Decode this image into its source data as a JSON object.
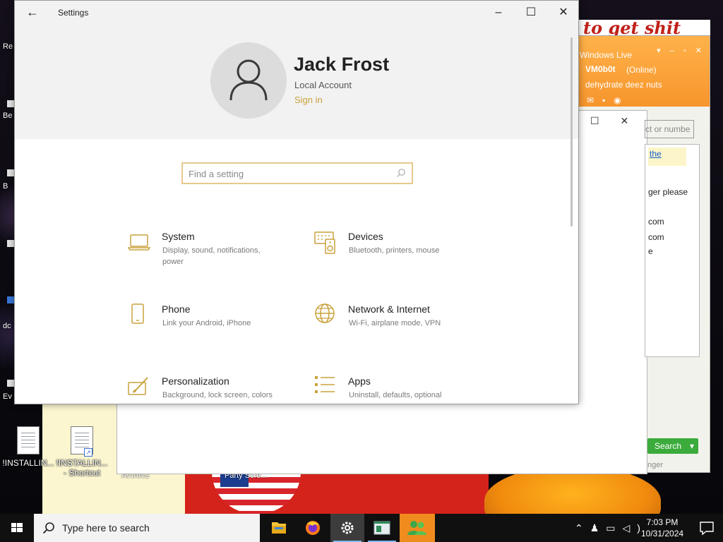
{
  "settings": {
    "title": "Settings",
    "account": {
      "name": "Jack Frost",
      "type": "Local Account",
      "sign_in": "Sign in"
    },
    "search_placeholder": "Find a setting",
    "categories": [
      {
        "title": "System",
        "desc": "Display, sound, notifications, power",
        "icon": "laptop-icon"
      },
      {
        "title": "Devices",
        "desc": "Bluetooth, printers, mouse",
        "icon": "keyboard-speaker-icon"
      },
      {
        "title": "Phone",
        "desc": "Link your Android, iPhone",
        "icon": "phone-icon"
      },
      {
        "title": "Network & Internet",
        "desc": "Wi-Fi, airplane mode, VPN",
        "icon": "globe-icon"
      },
      {
        "title": "Personalization",
        "desc": "Background, lock screen, colors",
        "icon": "paint-brush-icon"
      },
      {
        "title": "Apps",
        "desc": "Uninstall, defaults, optional",
        "icon": "apps-list-icon"
      }
    ]
  },
  "messenger": {
    "title": "Windows Live",
    "user": "VM0b0t",
    "status": "(Online)",
    "personal_message": "dehydrate deez nuts",
    "find_placeholder": "ct or numbe",
    "link_text": "the",
    "lines": [
      "ger please",
      "com",
      "com",
      "e"
    ],
    "search_button": "Search",
    "bottom_text": "nger"
  },
  "desktop": {
    "icons": [
      {
        "label": "!INSTALLIN..."
      },
      {
        "label": "!INSTALLIN... - Shortcut"
      }
    ],
    "partial_labels": [
      "AVIANS",
      "Party Scre..."
    ],
    "side_labels": [
      "Re",
      "Be",
      "B",
      "dc",
      "Ev"
    ],
    "wall_text": "to get shit"
  },
  "taskbar": {
    "search_placeholder": "Type here to search",
    "apps": [
      "file-explorer-icon",
      "firefox-icon",
      "settings-gear-icon",
      "task-window-icon",
      "messenger-people-icon"
    ],
    "time": "7:03 PM",
    "date": "10/31/2024"
  },
  "colors": {
    "accent": "#c9a23b",
    "search_border": "#e6c98f",
    "taskbar": "#101010",
    "messenger_orange": "#f7952c"
  }
}
